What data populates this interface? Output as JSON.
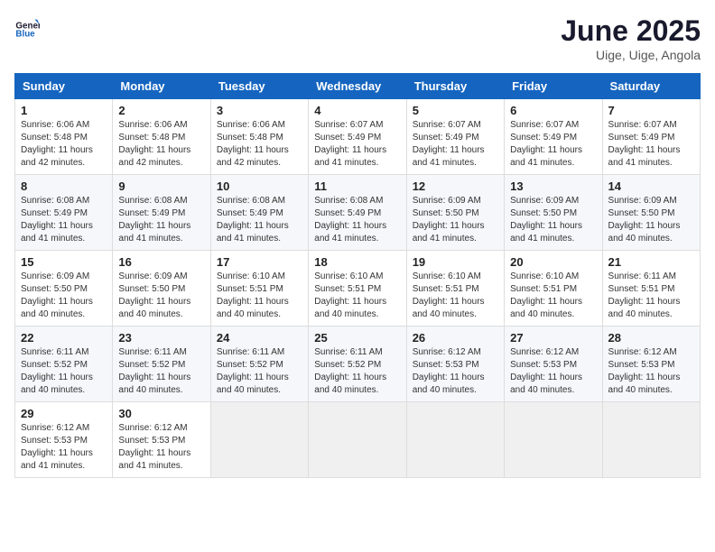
{
  "header": {
    "logo_general": "General",
    "logo_blue": "Blue",
    "month_title": "June 2025",
    "location": "Uige, Uige, Angola"
  },
  "weekdays": [
    "Sunday",
    "Monday",
    "Tuesday",
    "Wednesday",
    "Thursday",
    "Friday",
    "Saturday"
  ],
  "weeks": [
    [
      {
        "day": "1",
        "sunrise": "Sunrise: 6:06 AM",
        "sunset": "Sunset: 5:48 PM",
        "daylight": "Daylight: 11 hours and 42 minutes."
      },
      {
        "day": "2",
        "sunrise": "Sunrise: 6:06 AM",
        "sunset": "Sunset: 5:48 PM",
        "daylight": "Daylight: 11 hours and 42 minutes."
      },
      {
        "day": "3",
        "sunrise": "Sunrise: 6:06 AM",
        "sunset": "Sunset: 5:48 PM",
        "daylight": "Daylight: 11 hours and 42 minutes."
      },
      {
        "day": "4",
        "sunrise": "Sunrise: 6:07 AM",
        "sunset": "Sunset: 5:49 PM",
        "daylight": "Daylight: 11 hours and 41 minutes."
      },
      {
        "day": "5",
        "sunrise": "Sunrise: 6:07 AM",
        "sunset": "Sunset: 5:49 PM",
        "daylight": "Daylight: 11 hours and 41 minutes."
      },
      {
        "day": "6",
        "sunrise": "Sunrise: 6:07 AM",
        "sunset": "Sunset: 5:49 PM",
        "daylight": "Daylight: 11 hours and 41 minutes."
      },
      {
        "day": "7",
        "sunrise": "Sunrise: 6:07 AM",
        "sunset": "Sunset: 5:49 PM",
        "daylight": "Daylight: 11 hours and 41 minutes."
      }
    ],
    [
      {
        "day": "8",
        "sunrise": "Sunrise: 6:08 AM",
        "sunset": "Sunset: 5:49 PM",
        "daylight": "Daylight: 11 hours and 41 minutes."
      },
      {
        "day": "9",
        "sunrise": "Sunrise: 6:08 AM",
        "sunset": "Sunset: 5:49 PM",
        "daylight": "Daylight: 11 hours and 41 minutes."
      },
      {
        "day": "10",
        "sunrise": "Sunrise: 6:08 AM",
        "sunset": "Sunset: 5:49 PM",
        "daylight": "Daylight: 11 hours and 41 minutes."
      },
      {
        "day": "11",
        "sunrise": "Sunrise: 6:08 AM",
        "sunset": "Sunset: 5:49 PM",
        "daylight": "Daylight: 11 hours and 41 minutes."
      },
      {
        "day": "12",
        "sunrise": "Sunrise: 6:09 AM",
        "sunset": "Sunset: 5:50 PM",
        "daylight": "Daylight: 11 hours and 41 minutes."
      },
      {
        "day": "13",
        "sunrise": "Sunrise: 6:09 AM",
        "sunset": "Sunset: 5:50 PM",
        "daylight": "Daylight: 11 hours and 41 minutes."
      },
      {
        "day": "14",
        "sunrise": "Sunrise: 6:09 AM",
        "sunset": "Sunset: 5:50 PM",
        "daylight": "Daylight: 11 hours and 40 minutes."
      }
    ],
    [
      {
        "day": "15",
        "sunrise": "Sunrise: 6:09 AM",
        "sunset": "Sunset: 5:50 PM",
        "daylight": "Daylight: 11 hours and 40 minutes."
      },
      {
        "day": "16",
        "sunrise": "Sunrise: 6:09 AM",
        "sunset": "Sunset: 5:50 PM",
        "daylight": "Daylight: 11 hours and 40 minutes."
      },
      {
        "day": "17",
        "sunrise": "Sunrise: 6:10 AM",
        "sunset": "Sunset: 5:51 PM",
        "daylight": "Daylight: 11 hours and 40 minutes."
      },
      {
        "day": "18",
        "sunrise": "Sunrise: 6:10 AM",
        "sunset": "Sunset: 5:51 PM",
        "daylight": "Daylight: 11 hours and 40 minutes."
      },
      {
        "day": "19",
        "sunrise": "Sunrise: 6:10 AM",
        "sunset": "Sunset: 5:51 PM",
        "daylight": "Daylight: 11 hours and 40 minutes."
      },
      {
        "day": "20",
        "sunrise": "Sunrise: 6:10 AM",
        "sunset": "Sunset: 5:51 PM",
        "daylight": "Daylight: 11 hours and 40 minutes."
      },
      {
        "day": "21",
        "sunrise": "Sunrise: 6:11 AM",
        "sunset": "Sunset: 5:51 PM",
        "daylight": "Daylight: 11 hours and 40 minutes."
      }
    ],
    [
      {
        "day": "22",
        "sunrise": "Sunrise: 6:11 AM",
        "sunset": "Sunset: 5:52 PM",
        "daylight": "Daylight: 11 hours and 40 minutes."
      },
      {
        "day": "23",
        "sunrise": "Sunrise: 6:11 AM",
        "sunset": "Sunset: 5:52 PM",
        "daylight": "Daylight: 11 hours and 40 minutes."
      },
      {
        "day": "24",
        "sunrise": "Sunrise: 6:11 AM",
        "sunset": "Sunset: 5:52 PM",
        "daylight": "Daylight: 11 hours and 40 minutes."
      },
      {
        "day": "25",
        "sunrise": "Sunrise: 6:11 AM",
        "sunset": "Sunset: 5:52 PM",
        "daylight": "Daylight: 11 hours and 40 minutes."
      },
      {
        "day": "26",
        "sunrise": "Sunrise: 6:12 AM",
        "sunset": "Sunset: 5:53 PM",
        "daylight": "Daylight: 11 hours and 40 minutes."
      },
      {
        "day": "27",
        "sunrise": "Sunrise: 6:12 AM",
        "sunset": "Sunset: 5:53 PM",
        "daylight": "Daylight: 11 hours and 40 minutes."
      },
      {
        "day": "28",
        "sunrise": "Sunrise: 6:12 AM",
        "sunset": "Sunset: 5:53 PM",
        "daylight": "Daylight: 11 hours and 40 minutes."
      }
    ],
    [
      {
        "day": "29",
        "sunrise": "Sunrise: 6:12 AM",
        "sunset": "Sunset: 5:53 PM",
        "daylight": "Daylight: 11 hours and 41 minutes."
      },
      {
        "day": "30",
        "sunrise": "Sunrise: 6:12 AM",
        "sunset": "Sunset: 5:53 PM",
        "daylight": "Daylight: 11 hours and 41 minutes."
      },
      null,
      null,
      null,
      null,
      null
    ]
  ]
}
